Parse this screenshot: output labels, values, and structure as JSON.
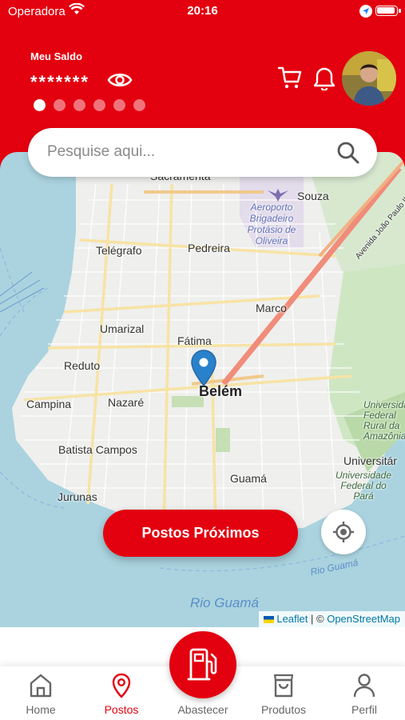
{
  "status_bar": {
    "carrier": "Operadora",
    "time": "20:16"
  },
  "balance": {
    "label": "Meu Saldo",
    "masked_value": "*******",
    "carousel_pages": 6,
    "active_page": 1
  },
  "search": {
    "placeholder": "Pesquise aqui..."
  },
  "map": {
    "labels": {
      "sacramenta": "Sacramenta",
      "souza": "Souza",
      "aeroporto": "Aeroporto Brigadeiro Protásio de Oliveira",
      "telegrafo": "Telégrafo",
      "pedreira": "Pedreira",
      "marco": "Marco",
      "umarizal": "Umarizal",
      "fatima": "Fátima",
      "reduto": "Reduto",
      "belem": "Belém",
      "nazare": "Nazaré",
      "campina": "Campina",
      "batista_campos": "Batista Campos",
      "guama": "Guamá",
      "jurunas": "Jurunas",
      "universitario": "Universitár",
      "ufra": "Universidade Federal Rural da Amazônia",
      "ufpa": "Universidade Federal do Pará",
      "rio_guama": "Rio Guamá",
      "rio_guama_small": "Rio Guamá",
      "avenida": "Avenida João Paulo II"
    },
    "attribution": {
      "leaflet": "Leaflet",
      "separator": "| ©",
      "osm": "OpenStreetMap"
    },
    "nearby_button": "Postos Próximos"
  },
  "bottom_nav": {
    "items": [
      {
        "label": "Home"
      },
      {
        "label": "Postos"
      },
      {
        "label": "Abastecer"
      },
      {
        "label": "Produtos"
      },
      {
        "label": "Perfil"
      }
    ],
    "active": "Postos"
  },
  "colors": {
    "brand_red": "#e3000f",
    "inactive": "#666666",
    "map_water": "#aad3df"
  }
}
